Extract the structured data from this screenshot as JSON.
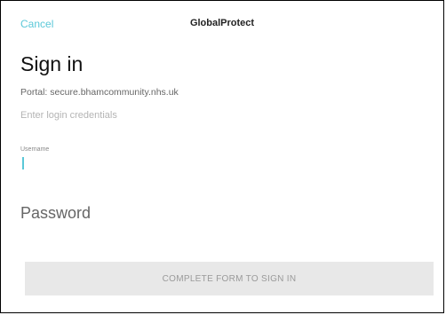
{
  "nav": {
    "cancel_label": "Cancel",
    "title": "GlobalProtect"
  },
  "form": {
    "heading": "Sign in",
    "portal": "Portal: secure.bhamcommunity.nhs.uk",
    "prompt": "Enter login credentials",
    "username": {
      "label": "Username",
      "value": ""
    },
    "password": {
      "placeholder": "Password",
      "value": ""
    },
    "submit_label": "COMPLETE FORM TO SIGN IN"
  },
  "colors": {
    "accent": "#5bc8d8",
    "button_bg": "#e8e8e8",
    "button_text": "#9a9a9a"
  }
}
